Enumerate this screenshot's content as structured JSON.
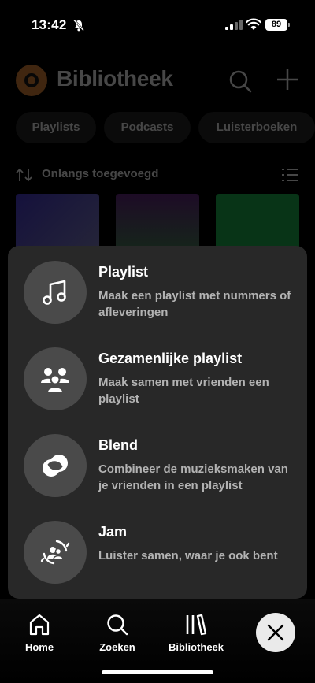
{
  "status_bar": {
    "time": "13:42",
    "battery": "89"
  },
  "library": {
    "title": "Bibliotheek",
    "chips": [
      "Playlists",
      "Podcasts",
      "Luisterboeken"
    ],
    "sort_label": "Onlangs toegevoegd"
  },
  "create_menu": {
    "options": [
      {
        "title": "Playlist",
        "description": "Maak een playlist met nummers of afleveringen",
        "icon": "music-note-icon"
      },
      {
        "title": "Gezamenlijke playlist",
        "description": "Maak samen met vrienden een playlist",
        "icon": "people-icon"
      },
      {
        "title": "Blend",
        "description": "Combineer de muzieksmaken van je vrienden in een playlist",
        "icon": "blend-icon"
      },
      {
        "title": "Jam",
        "description": "Luister samen, waar je ook bent",
        "icon": "jam-icon"
      }
    ]
  },
  "bottom_nav": {
    "items": [
      {
        "label": "Home",
        "icon": "home-icon"
      },
      {
        "label": "Zoeken",
        "icon": "search-icon"
      },
      {
        "label": "Bibliotheek",
        "icon": "library-icon"
      }
    ]
  },
  "colors": {
    "sheet": "#282828",
    "icon_circle": "#4a4a4a",
    "secondary_text": "#b3b3b3",
    "avatar": "#e78a3a"
  }
}
